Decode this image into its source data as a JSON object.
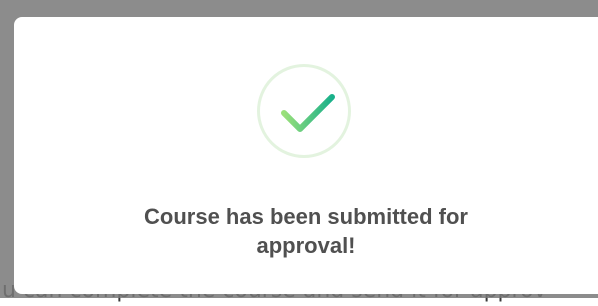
{
  "background": {
    "partial_text": "u can complete the course and send it for approv"
  },
  "modal": {
    "icon": "check-circle-icon",
    "message_line1": "Course has been submitted for",
    "message_line2": "approval!",
    "colors": {
      "check_start": "#9be07a",
      "check_end": "#18b08a",
      "ring": "#e3f3df",
      "text": "#505050",
      "overlay": "#7a7a7a"
    }
  }
}
